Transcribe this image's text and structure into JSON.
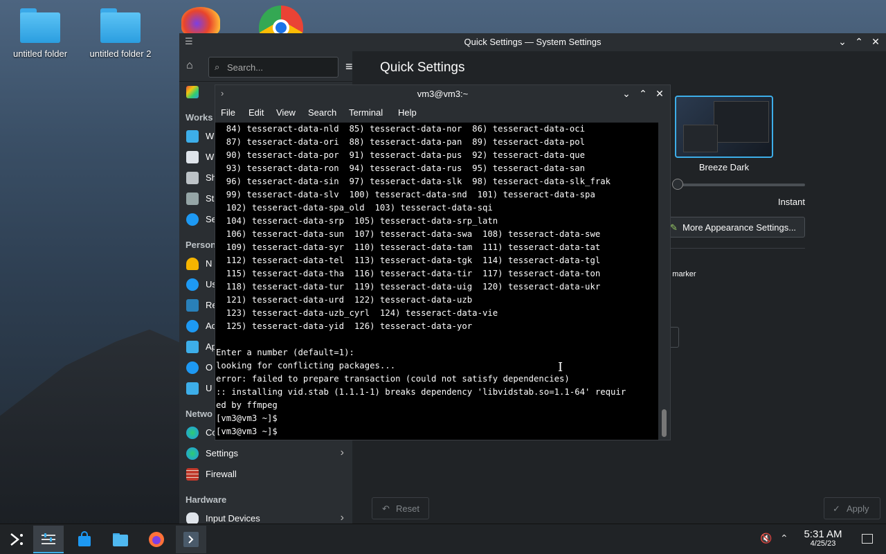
{
  "desktop": {
    "icons": [
      {
        "label": "untitled folder"
      },
      {
        "label": "untitled folder 2"
      }
    ]
  },
  "system_settings": {
    "title": "Quick Settings — System Settings",
    "search_placeholder": "Search...",
    "page_title": "Quick Settings",
    "sections": {
      "workspace": "Works",
      "personalization": "Person",
      "network": "Netwo",
      "hardware": "Hardware"
    },
    "sidebar_items": [
      {
        "label": "W",
        "icon": "workspace-behavior-icon"
      },
      {
        "label": "W",
        "icon": "window-management-icon"
      },
      {
        "label": "Sh",
        "icon": "shortcuts-icon"
      },
      {
        "label": "St",
        "icon": "startup-icon"
      },
      {
        "label": "Se",
        "icon": "search-icon"
      },
      {
        "label": "N",
        "icon": "notifications-icon"
      },
      {
        "label": "Us",
        "icon": "users-icon"
      },
      {
        "label": "Re",
        "icon": "regional-icon"
      },
      {
        "label": "Ac",
        "icon": "accessibility-icon"
      },
      {
        "label": "Ap",
        "icon": "applications-icon"
      },
      {
        "label": "O",
        "icon": "online-accounts-icon"
      },
      {
        "label": "U",
        "icon": "user-feedback-icon"
      },
      {
        "label": "Co",
        "icon": "connections-icon"
      },
      {
        "label": "Settings",
        "icon": "network-settings-icon"
      },
      {
        "label": "Firewall",
        "icon": "firewall-icon"
      },
      {
        "label": "Input Devices",
        "icon": "input-devices-icon"
      }
    ],
    "theme_name": "Breeze Dark",
    "animation_speed_label": "Instant",
    "more_appearance_button": "More Appearance Settings...",
    "marker_text": "en marker",
    "reset_button": "Reset",
    "apply_button": "Apply"
  },
  "terminal": {
    "title": "vm3@vm3:~",
    "menu": [
      "File",
      "Edit",
      "View",
      "Search",
      "Terminal",
      "Help"
    ],
    "lines": [
      "  84) tesseract-data-nld  85) tesseract-data-nor  86) tesseract-data-oci",
      "  87) tesseract-data-ori  88) tesseract-data-pan  89) tesseract-data-pol",
      "  90) tesseract-data-por  91) tesseract-data-pus  92) tesseract-data-que",
      "  93) tesseract-data-ron  94) tesseract-data-rus  95) tesseract-data-san",
      "  96) tesseract-data-sin  97) tesseract-data-slk  98) tesseract-data-slk_frak",
      "  99) tesseract-data-slv  100) tesseract-data-snd  101) tesseract-data-spa",
      "  102) tesseract-data-spa_old  103) tesseract-data-sqi",
      "  104) tesseract-data-srp  105) tesseract-data-srp_latn",
      "  106) tesseract-data-sun  107) tesseract-data-swa  108) tesseract-data-swe",
      "  109) tesseract-data-syr  110) tesseract-data-tam  111) tesseract-data-tat",
      "  112) tesseract-data-tel  113) tesseract-data-tgk  114) tesseract-data-tgl",
      "  115) tesseract-data-tha  116) tesseract-data-tir  117) tesseract-data-ton",
      "  118) tesseract-data-tur  119) tesseract-data-uig  120) tesseract-data-ukr",
      "  121) tesseract-data-urd  122) tesseract-data-uzb",
      "  123) tesseract-data-uzb_cyrl  124) tesseract-data-vie",
      "  125) tesseract-data-yid  126) tesseract-data-yor",
      "",
      "Enter a number (default=1):",
      "looking for conflicting packages...",
      "error: failed to prepare transaction (could not satisfy dependencies)",
      ":: installing vid.stab (1.1.1-1) breaks dependency 'libvidstab.so=1.1-64' requir",
      "ed by ffmpeg",
      "[vm3@vm3 ~]$",
      "[vm3@vm3 ~]$"
    ]
  },
  "taskbar": {
    "time": "5:31 AM",
    "date": "4/25/23"
  },
  "colors": {
    "accent": "#3daee9",
    "window_bg": "#202326",
    "panel_bg": "#2a2e32"
  }
}
